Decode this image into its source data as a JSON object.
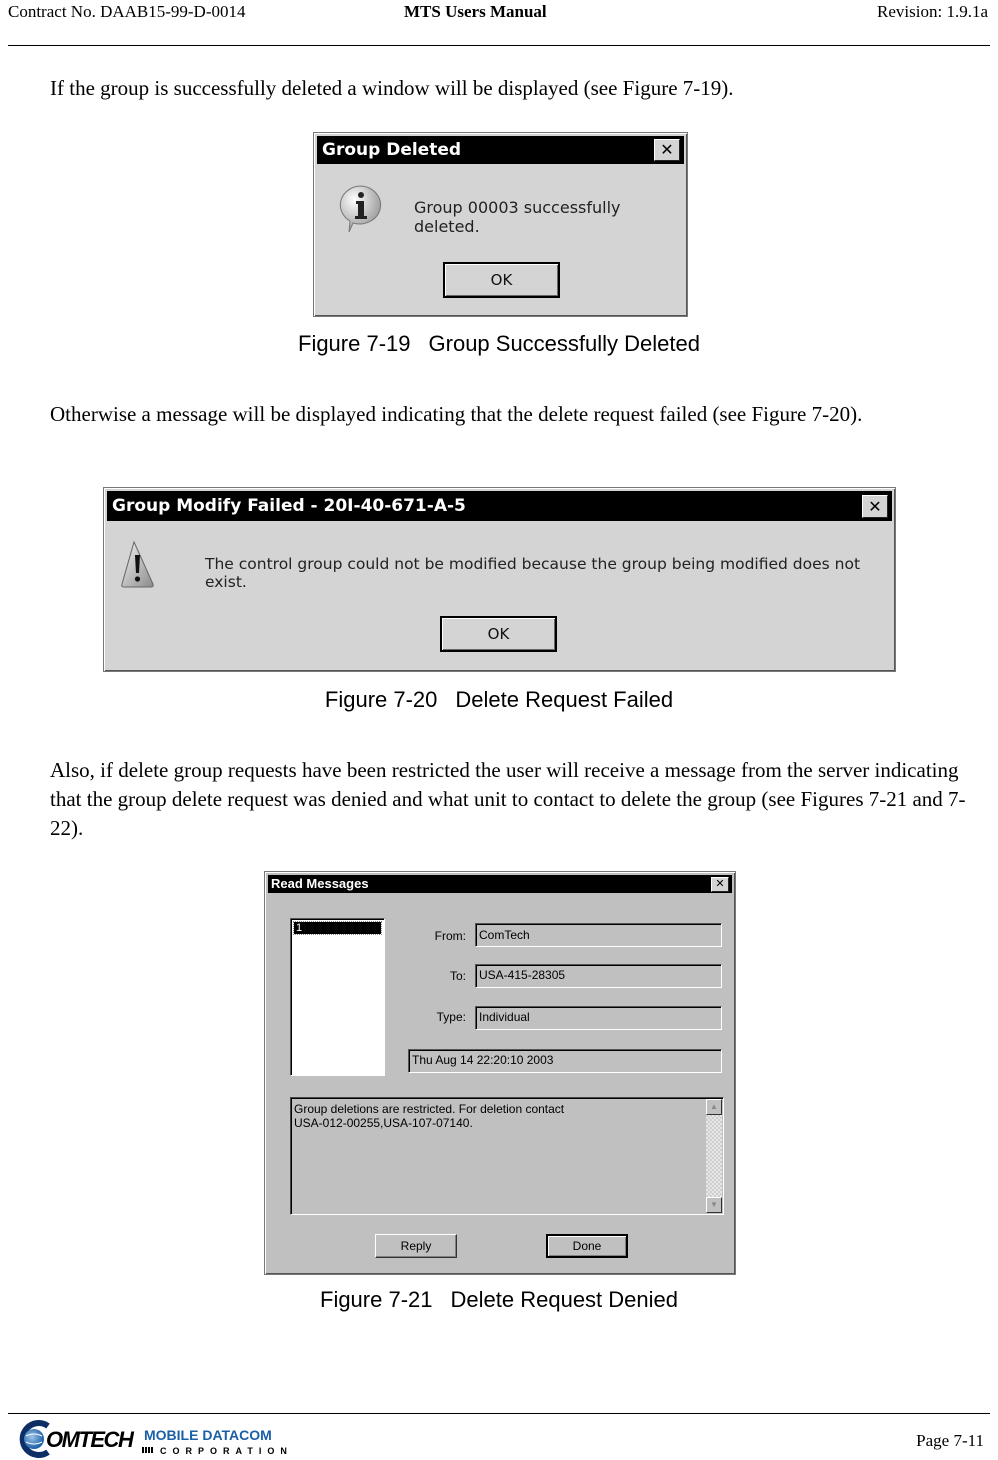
{
  "header": {
    "contract": "Contract No. DAAB15-99-D-0014",
    "title": "MTS Users Manual",
    "revision": "Revision:  1.9.1a"
  },
  "paragraphs": [
    "If the group is successfully deleted a window will be displayed (see Figure 7-19).",
    "Otherwise a message will be displayed indicating that the delete request failed (see Figure 7-20).",
    "Also, if delete group requests have been restricted the user will receive a message from the server indicating that the group delete request was denied and what unit to contact to delete the group (see Figures 7-21 and 7-22)."
  ],
  "figures": [
    {
      "number": "Figure 7-19",
      "caption": "Group Successfully Deleted",
      "dialog": {
        "title": "Group Deleted",
        "icon": "info-icon",
        "message": "Group 00003 successfully deleted.",
        "ok_label": "OK",
        "close_label": "✕"
      }
    },
    {
      "number": "Figure 7-20",
      "caption": "Delete Request Failed",
      "dialog": {
        "title": "Group Modify Failed - 20I-40-671-A-5",
        "icon": "warning-icon",
        "message": "The control group could not be modified because the group being modified does not exist.",
        "ok_label": "OK",
        "close_label": "✕"
      }
    },
    {
      "number": "Figure 7-21",
      "caption": "Delete Request Denied",
      "dialog": {
        "title": "Read Messages",
        "close_label": "✕",
        "list_items": [
          "1"
        ],
        "from_label": "From:",
        "from_value": "ComTech",
        "to_label": "To:",
        "to_value": "USA-415-28305",
        "type_label": "Type:",
        "type_value": "Individual",
        "timestamp": "Thu Aug 14 22:20:10 2003",
        "message_lines": [
          "Group deletions are restricted. For deletion contact",
          "USA-012-00255,USA-107-07140."
        ],
        "reply_label": "Reply",
        "done_label": "Done"
      }
    }
  ],
  "footer": {
    "logo_main": "OMTECH",
    "logo_brand": "MOBILE DATACOM",
    "logo_sub": "CORPORATION",
    "page": "Page 7-11",
    "brand_color": "#1a5fa8"
  }
}
